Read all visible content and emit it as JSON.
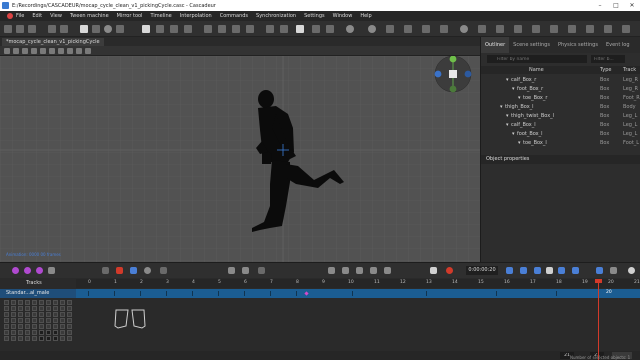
{
  "window": {
    "title": "E:/Recordings/CASCADEUR/mocap_cycle_clean_v1_pickingCycle.casc - Cascadeur"
  },
  "menu": [
    "File",
    "Edit",
    "View",
    "Tween machine",
    "Mirror tool",
    "Timeline",
    "Interpolation",
    "Commands",
    "Synchronization",
    "Settings",
    "Window",
    "Help"
  ],
  "doc_tab": "*mocap_cycle_clean_v1_pickingCycle",
  "viewport": {
    "status": "Animation: 0000 00 frames"
  },
  "right_panel": {
    "tabs": [
      "Outliner",
      "Scene settings",
      "Physics settings",
      "Event log"
    ],
    "filter_placeholder": "Filter by name",
    "filter2_placeholder": "Filter b...",
    "columns": {
      "name": "Name",
      "type": "Type",
      "track": "Track"
    },
    "rows": [
      {
        "name": "calf_Box_r",
        "type": "Box",
        "track": "Leg_R",
        "indent": 1
      },
      {
        "name": "foot_Box_r",
        "type": "Box",
        "track": "Leg_R",
        "indent": 2
      },
      {
        "name": "toe_Box_r",
        "type": "Box",
        "track": "Foot_R",
        "indent": 3
      },
      {
        "name": "thigh_Box_l",
        "type": "Box",
        "track": "Body",
        "indent": 0
      },
      {
        "name": "thigh_twist_Box_l",
        "type": "Box",
        "track": "Leg_L",
        "indent": 1
      },
      {
        "name": "calf_Box_l",
        "type": "Box",
        "track": "Leg_L",
        "indent": 1
      },
      {
        "name": "foot_Box_l",
        "type": "Box",
        "track": "Leg_L",
        "indent": 2
      },
      {
        "name": "toe_Box_l",
        "type": "Box",
        "track": "Foot_L",
        "indent": 3
      }
    ],
    "properties_title": "Object properties"
  },
  "timeline": {
    "time": "0:00:00:20",
    "tracks_label": "Tracks",
    "track_name": "Standar...al_male",
    "ruler": [
      0,
      1,
      2,
      3,
      4,
      5,
      6,
      7,
      8,
      9,
      10,
      11,
      12,
      13,
      14,
      15,
      16,
      17,
      18,
      19,
      20,
      21
    ],
    "current_frame": "20",
    "frame_start": "21",
    "frame_end": "21",
    "selected_status": "Number of selected objects: 1"
  }
}
